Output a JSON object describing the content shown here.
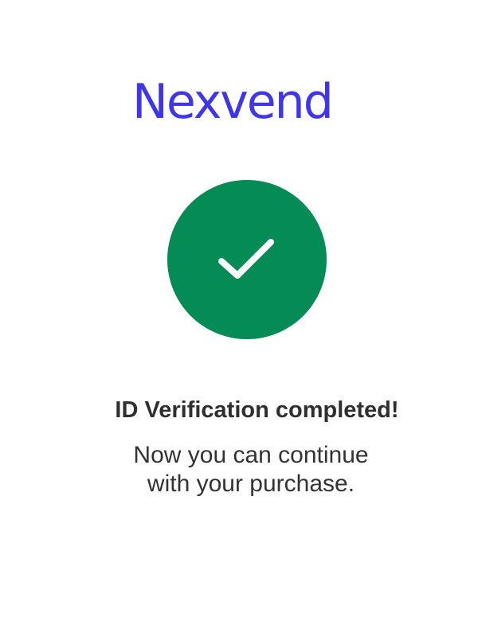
{
  "brand": {
    "name": "Nexvend",
    "color": "#3f35ea"
  },
  "status": {
    "icon": "check-icon",
    "circle_color": "#058b55",
    "check_color": "#ffffff"
  },
  "confirmation": {
    "title": "ID Verification completed!",
    "message_line_1": "Now you can continue",
    "message_line_2": "with your purchase."
  }
}
